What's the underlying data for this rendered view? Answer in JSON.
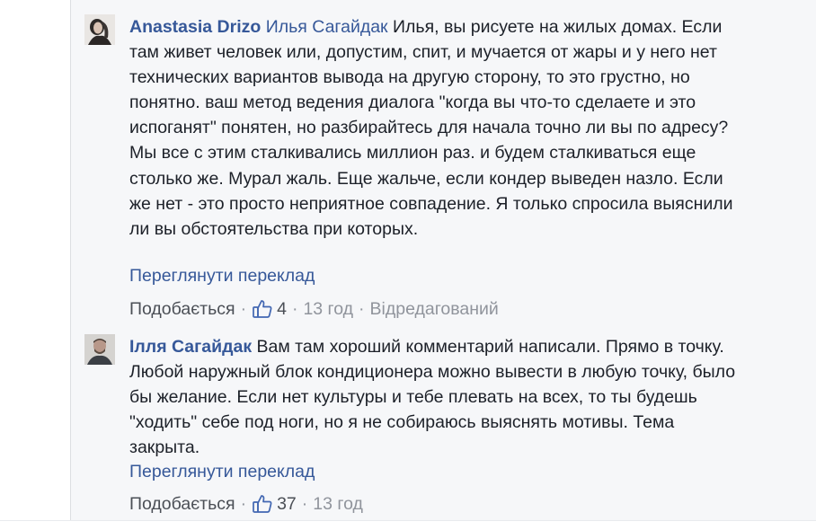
{
  "comments": [
    {
      "author": "Anastasia Drizo",
      "mention": "Илья Сагайдак",
      "text": " Илья, вы рисуете на жилых домах. Если там живет человек или, допустим, спит, и мучается от жары и у него нет технических вариантов вывода на другую сторону, то это грустно, но понятно. ваш метод ведения диалога \"когда вы что-то сделаете и это испоганят\" понятен, но разбирайтесь для начала точно ли вы по адресу? Мы все с этим сталкивались миллион раз. и будем сталкиваться еще столько же. Мурал жаль. Еще жальче, если кондер выведен назло. Если же нет - это просто неприятное совпадение. Я только спросила выяснили ли вы обстоятельства при которых.",
      "translate": "Переглянути переклад",
      "like_label": "Подобається",
      "like_count": "4",
      "time": "13 год",
      "edited": "Відредагований"
    },
    {
      "author": "Ілля Сагайдак",
      "text": " Вам там хороший комментарий написали. Прямо в точку. Любой наружный блок кондиционера можно вывести в любую точку, было бы желание. Если нет культуры и тебе плевать на всех, то ты будешь \"ходить\" себе под ноги, но я не собираюсь выяснять мотивы. Тема закрыта.",
      "translate": "Переглянути переклад",
      "like_label": "Подобається",
      "like_count": "37",
      "time": "13 год"
    }
  ],
  "separator": "·",
  "icons": {
    "like": "thumbs-up-icon"
  },
  "colors": {
    "link": "#365899",
    "text": "#1d2129",
    "meta": "#90949c"
  }
}
